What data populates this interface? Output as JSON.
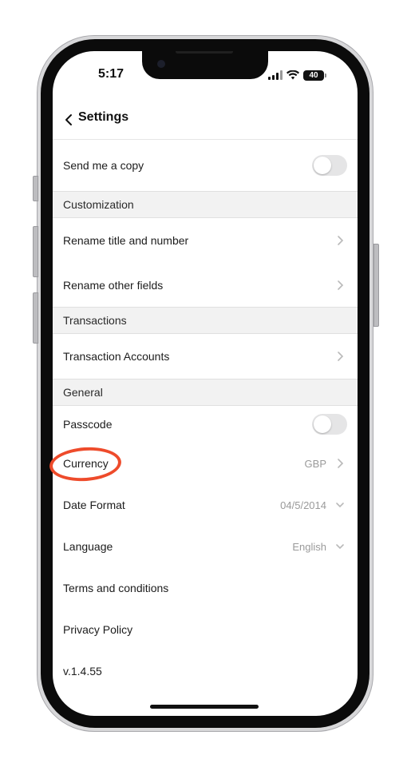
{
  "status_bar": {
    "time": "5:17",
    "battery_level": "40"
  },
  "nav": {
    "title": "Settings"
  },
  "items": {
    "send_copy": {
      "label": "Send me a copy",
      "toggle_on": false
    },
    "rename_title": {
      "label": "Rename title and number"
    },
    "rename_fields": {
      "label": "Rename other fields"
    },
    "transaction_accounts": {
      "label": "Transaction Accounts"
    },
    "passcode": {
      "label": "Passcode",
      "toggle_on": false
    },
    "currency": {
      "label": "Currency",
      "value": "GBP"
    },
    "date_format": {
      "label": "Date Format",
      "value": "04/5/2014"
    },
    "language": {
      "label": "Language",
      "value": "English"
    },
    "terms": {
      "label": "Terms and conditions"
    },
    "privacy": {
      "label": "Privacy Policy"
    },
    "version": {
      "label": "v.1.4.55"
    }
  },
  "sections": {
    "customization": "Customization",
    "transactions": "Transactions",
    "general": "General"
  },
  "icons": [
    "chevron-left-icon",
    "chevron-right-icon",
    "chevron-down-icon",
    "signal-icon",
    "wifi-icon",
    "battery-icon"
  ],
  "colors": {
    "annotation": "#ee4b2b",
    "section_bg": "#f2f2f2",
    "toggle_off": "#e5e5e6"
  }
}
